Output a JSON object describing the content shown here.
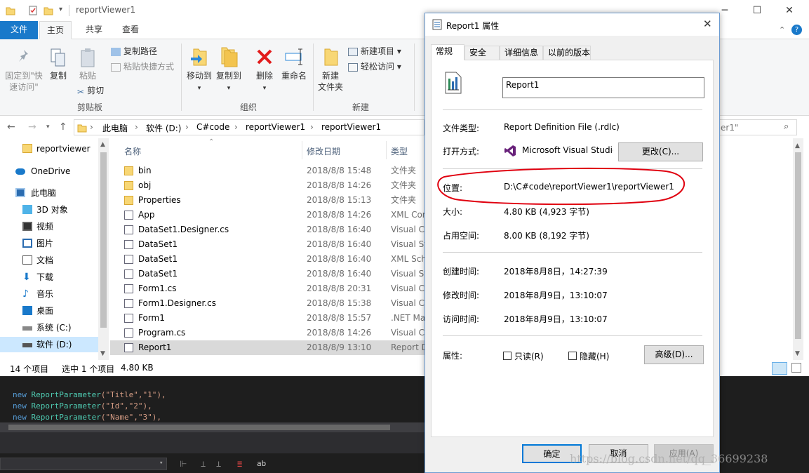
{
  "explorer": {
    "title": "reportViewer1",
    "ribbon_tabs": [
      "文件",
      "主页",
      "共享",
      "查看"
    ],
    "ribbon": {
      "pin_label_1": "固定到\"快",
      "pin_label_2": "速访问\"",
      "copy": "复制",
      "paste": "粘贴",
      "copy_path": "复制路径",
      "paste_shortcut": "粘贴快捷方式",
      "cut": "剪切",
      "group_clipboard": "剪贴板",
      "move_to": "移动到",
      "copy_to": "复制到",
      "delete": "删除",
      "rename": "重命名",
      "group_organize": "组织",
      "new_folder_1": "新建",
      "new_folder_2": "文件夹",
      "new_item": "新建项目",
      "easy_access": "轻松访问",
      "group_new": "新建"
    },
    "breadcrumb": [
      "此电脑",
      "软件 (D:)",
      "C#code",
      "reportViewer1",
      "reportViewer1"
    ],
    "search_text": "er1\"",
    "nav_items": [
      {
        "label": "reportviewer",
        "icon": "folder-icon"
      },
      {
        "label": "OneDrive",
        "icon": "cloud-icon"
      },
      {
        "label": "此电脑",
        "icon": "computer-icon"
      },
      {
        "label": "3D 对象",
        "icon": "cube-icon"
      },
      {
        "label": "视频",
        "icon": "video-icon"
      },
      {
        "label": "图片",
        "icon": "picture-icon"
      },
      {
        "label": "文档",
        "icon": "document-icon"
      },
      {
        "label": "下载",
        "icon": "download-icon"
      },
      {
        "label": "音乐",
        "icon": "music-icon"
      },
      {
        "label": "桌面",
        "icon": "desktop-icon"
      },
      {
        "label": "系统 (C:)",
        "icon": "drive-icon"
      },
      {
        "label": "软件 (D:)",
        "icon": "drive-icon"
      }
    ],
    "columns": {
      "name": "名称",
      "date": "修改日期",
      "type": "类型"
    },
    "files": [
      {
        "name": "bin",
        "date": "2018/8/8 15:48",
        "type": "文件夹"
      },
      {
        "name": "obj",
        "date": "2018/8/8 14:26",
        "type": "文件夹"
      },
      {
        "name": "Properties",
        "date": "2018/8/8 15:13",
        "type": "文件夹"
      },
      {
        "name": "App",
        "date": "2018/8/8 14:26",
        "type": "XML Configuration"
      },
      {
        "name": "DataSet1.Designer.cs",
        "date": "2018/8/8 16:40",
        "type": "Visual C#"
      },
      {
        "name": "DataSet1",
        "date": "2018/8/8 16:40",
        "type": "Visual Studio"
      },
      {
        "name": "DataSet1",
        "date": "2018/8/8 16:40",
        "type": "XML Schema"
      },
      {
        "name": "DataSet1",
        "date": "2018/8/8 16:40",
        "type": "Visual Studio"
      },
      {
        "name": "Form1.cs",
        "date": "2018/8/8 20:31",
        "type": "Visual C#"
      },
      {
        "name": "Form1.Designer.cs",
        "date": "2018/8/8 15:38",
        "type": "Visual C#"
      },
      {
        "name": "Form1",
        "date": "2018/8/8 15:57",
        "type": ".NET Managed"
      },
      {
        "name": "Program.cs",
        "date": "2018/8/8 14:26",
        "type": "Visual C#"
      },
      {
        "name": "Report1",
        "date": "2018/8/9 13:10",
        "type": "Report Definition"
      }
    ],
    "status": {
      "count": "14 个项目",
      "selected": "选中 1 个项目",
      "size": "4.80 KB"
    }
  },
  "code": {
    "lines": [
      {
        "kw": "new",
        "ty": "ReportParameter",
        "args": "(\"Title\",\"1\"),"
      },
      {
        "kw": "new",
        "ty": "ReportParameter",
        "args": "(\"Id\",\"2\"),"
      },
      {
        "kw": "new",
        "ty": "ReportParameter",
        "args": "(\"Name\",\"3\"),"
      }
    ]
  },
  "dialog": {
    "title": "Report1 属性",
    "tabs": [
      "常规",
      "安全",
      "详细信息",
      "以前的版本"
    ],
    "name_value": "Report1",
    "file_type_label": "文件类型:",
    "file_type_value": "Report Definition File (.rdlc)",
    "open_with_label": "打开方式:",
    "open_with_value": "Microsoft Visual Studio",
    "change_button": "更改(C)...",
    "location_label": "位置:",
    "location_value": "D:\\C#code\\reportViewer1\\reportViewer1",
    "size_label": "大小:",
    "size_value": "4.80 KB (4,923 字节)",
    "disk_label": "占用空间:",
    "disk_value": "8.00 KB (8,192 字节)",
    "created_label": "创建时间:",
    "created_value": "2018年8月8日，14:27:39",
    "modified_label": "修改时间:",
    "modified_value": "2018年8月9日，13:10:07",
    "accessed_label": "访问时间:",
    "accessed_value": "2018年8月9日，13:10:07",
    "attributes_label": "属性:",
    "readonly_label": "只读(R)",
    "hidden_label": "隐藏(H)",
    "advanced_button": "高级(D)...",
    "ok_button": "确定",
    "cancel_button": "取消",
    "apply_button": "应用(A)"
  },
  "watermark": "https://blog.csdn.net/qq_36699238",
  "colors": {
    "accent": "#1979ca",
    "annotation_red": "#e0000f",
    "selection": "#cce8ff"
  }
}
